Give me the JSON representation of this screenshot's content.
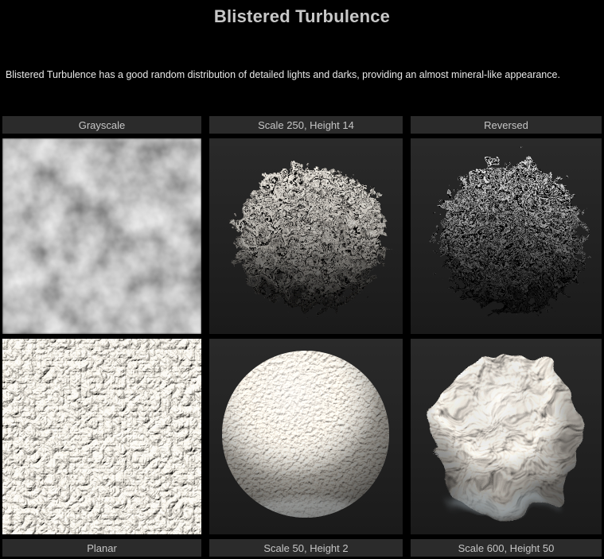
{
  "page": {
    "title": "Blistered Turbulence",
    "description": "Blistered Turbulence has a good random distribution of detailed lights and darks, providing an almost mineral-like appearance."
  },
  "table": {
    "headers": [
      "Grayscale",
      "Scale 250, Height 14",
      "Reversed"
    ],
    "footers": [
      "Planar",
      "Scale 50, Height 2",
      "Scale 600, Height 50"
    ],
    "previews": [
      {
        "name": "grayscale-noise-preview",
        "kind": "soft grayscale turbulence noise"
      },
      {
        "name": "sphere-scale-250-height-14-preview",
        "kind": "craggy displaced sphere render"
      },
      {
        "name": "sphere-reversed-preview",
        "kind": "dark high-contrast craggy sphere render"
      },
      {
        "name": "planar-texture-preview",
        "kind": "bright rocky planar texture render"
      },
      {
        "name": "sphere-scale-50-height-2-preview",
        "kind": "finely bumped smooth sphere render"
      },
      {
        "name": "sphere-scale-600-height-50-preview",
        "kind": "large lumpy displaced sphere render"
      }
    ]
  },
  "colors": {
    "page_background": "#000000",
    "label_cell_background": "#2b2b2b",
    "preview_background_top": "#2a2a2a",
    "preview_background_bottom": "#1a1a1a",
    "title_text": "#c8c8c8",
    "body_text": "#e8e8e8",
    "label_text": "#c6c6c6"
  }
}
